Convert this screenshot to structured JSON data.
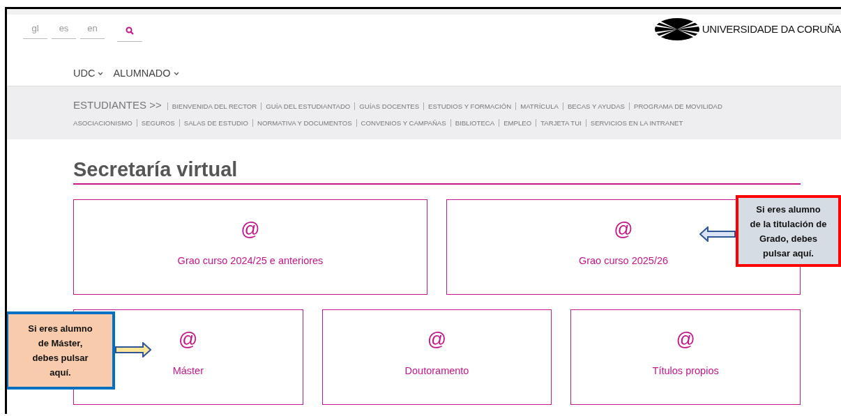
{
  "languages": [
    {
      "label": "gl"
    },
    {
      "label": "es"
    },
    {
      "label": "en"
    }
  ],
  "logo": {
    "text": "UNIVERSIDADE DA CORUÑA"
  },
  "menu": [
    {
      "label": "UDC"
    },
    {
      "label": "ALUMNADO"
    }
  ],
  "section_nav": {
    "title": "ESTUDIANTES >>",
    "links": [
      "BIENVENIDA DEL RECTOR",
      "GUÍA DEL ESTUDIANTADO",
      "GUÍAS DOCENTES",
      "ESTUDIOS Y FORMACIÓN",
      "MATRÍCULA",
      "BECAS Y AYUDAS",
      "PROGRAMA DE MOVILIDAD",
      "ASOCIACIONISMO",
      "SEGUROS",
      "SALAS DE ESTUDIO",
      "NORMATIVA Y DOCUMENTOS",
      "CONVENIOS Y CAMPAÑAS",
      "BIBLIOTECA",
      "EMPLEO",
      "TARJETA TUI",
      "SERVICIOS EN LA INTRANET"
    ]
  },
  "heading": "Secretaría virtual",
  "cards": [
    [
      {
        "icon": "@",
        "label": "Grao curso 2024/25 e anteriores"
      },
      {
        "icon": "@",
        "label": "Grao curso 2025/26"
      }
    ],
    [
      {
        "icon": "@",
        "label": "Máster"
      },
      {
        "icon": "@",
        "label": "Doutoramento"
      },
      {
        "icon": "@",
        "label": "Títulos propios"
      }
    ]
  ],
  "callouts": [
    {
      "text": "Si eres alumno de la titulación de Grado, debes pulsar aquí.",
      "color": "#d6dce4",
      "kind": "left"
    },
    {
      "text": "Si eres alumno de Máster, debes pulsar aquí.",
      "color": "#f8cbad",
      "kind": "right"
    }
  ]
}
